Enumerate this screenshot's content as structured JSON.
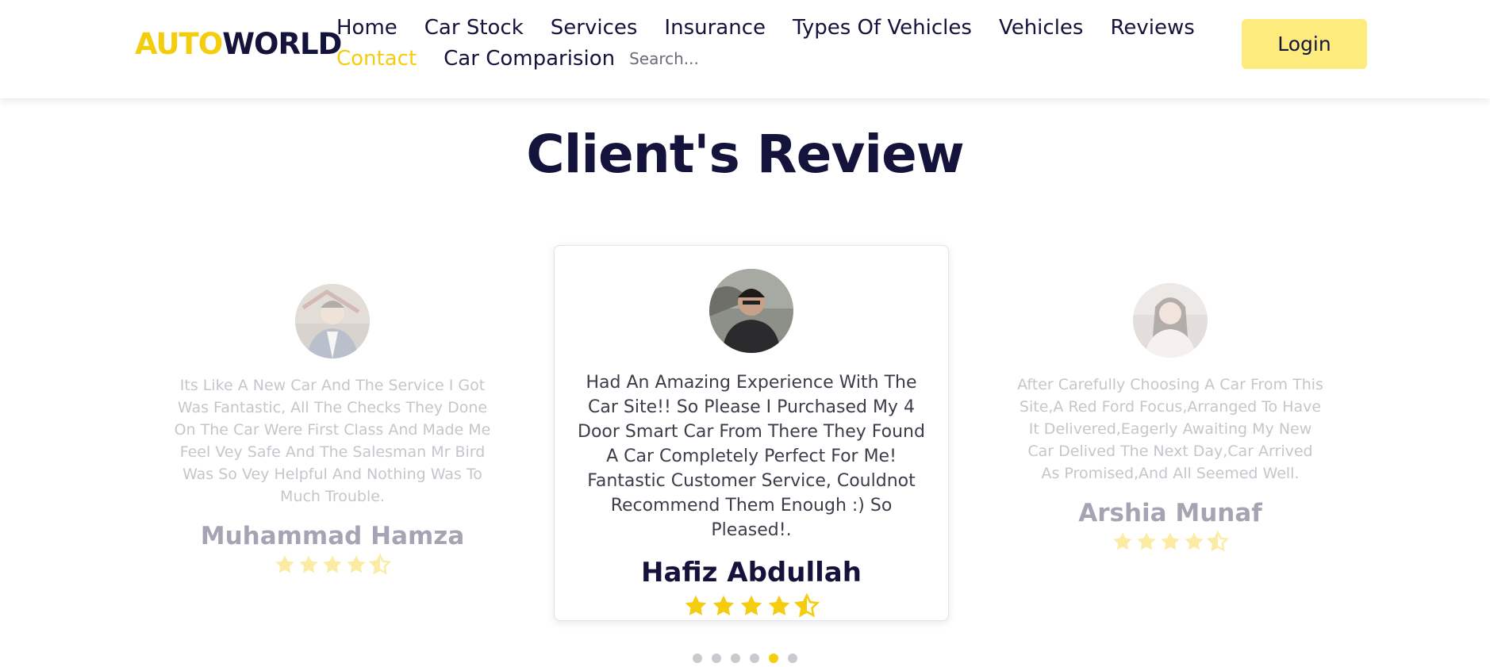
{
  "brand": {
    "part1": "AUTO",
    "part2": "WORLD"
  },
  "nav": {
    "row1": [
      "Home",
      "Car Stock",
      "Services",
      "Insurance",
      "Types Of Vehicles",
      "Vehicles",
      "Reviews"
    ],
    "contact": "Contact",
    "comparison": "Car Comparision",
    "search_placeholder": "Search..."
  },
  "login_label": "Login",
  "title": {
    "part1": "Client's",
    "part2": "Review"
  },
  "reviews": [
    {
      "quote": "Its Like A New Car And The Service I Got Was Fantastic, All The Checks They Done On The Car Were First Class And Made Me Feel Vey Safe And The Salesman Mr Bird Was So Vey Helpful And Nothing Was To Much Trouble.",
      "name": "Muhammad Hamza",
      "rating": 4.5
    },
    {
      "quote": "Had An Amazing Experience With The Car Site!! So Please I Purchased My 4 Door Smart Car From There They Found A Car Completely Perfect For Me! Fantastic Customer Service, Couldnot Recommend Them Enough :) So Pleased!.",
      "name": "Hafiz Abdullah",
      "rating": 4.5
    },
    {
      "quote": "After Carefully Choosing A Car From This Site,A Red Ford Focus,Arranged To Have It Delivered,Eagerly Awaiting My New Car Delived The Next Day,Car Arrived As Promised,And All Seemed Well.",
      "name": "Arshia Munaf",
      "rating": 4.5
    }
  ],
  "pagination": {
    "total": 6,
    "active_index": 4
  },
  "colors": {
    "accent": "#f5cd0f",
    "navy": "#14133b",
    "login_bg": "#fdeb7d"
  },
  "icons": {
    "avatar": "user-avatar-photo",
    "star": "star-icon",
    "half_star": "half-star-icon"
  }
}
